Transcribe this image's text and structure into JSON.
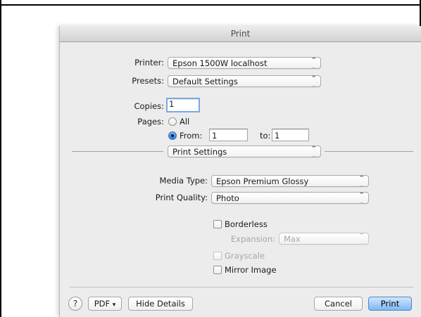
{
  "window": {
    "title": "Print"
  },
  "printer": {
    "label": "Printer:",
    "value": "Epson 1500W localhost"
  },
  "presets": {
    "label": "Presets:",
    "value": "Default Settings"
  },
  "copies": {
    "label": "Copies:",
    "value": "1"
  },
  "pages": {
    "label": "Pages:",
    "all_label": "All",
    "from_label": "From:",
    "from_value": "1",
    "to_label": "to:",
    "to_value": "1",
    "selected": "From"
  },
  "section": {
    "value": "Print Settings"
  },
  "media_type": {
    "label": "Media Type:",
    "value": "Epson Premium Glossy"
  },
  "print_quality": {
    "label": "Print Quality:",
    "value": "Photo"
  },
  "borderless": {
    "label": "Borderless",
    "checked": false
  },
  "expansion": {
    "label": "Expansion:",
    "value": "Max",
    "enabled": false
  },
  "grayscale": {
    "label": "Grayscale",
    "checked": false,
    "enabled": false
  },
  "mirror_image": {
    "label": "Mirror Image",
    "checked": false
  },
  "footer": {
    "help_glyph": "?",
    "pdf_label": "PDF",
    "pdf_arrow": "▾",
    "hide_details_label": "Hide Details",
    "cancel_label": "Cancel",
    "print_label": "Print"
  },
  "colors": {
    "accent": "#2a7fe3",
    "focus_ring": "#7aa9e6",
    "dialog_bg": "#ececec"
  }
}
